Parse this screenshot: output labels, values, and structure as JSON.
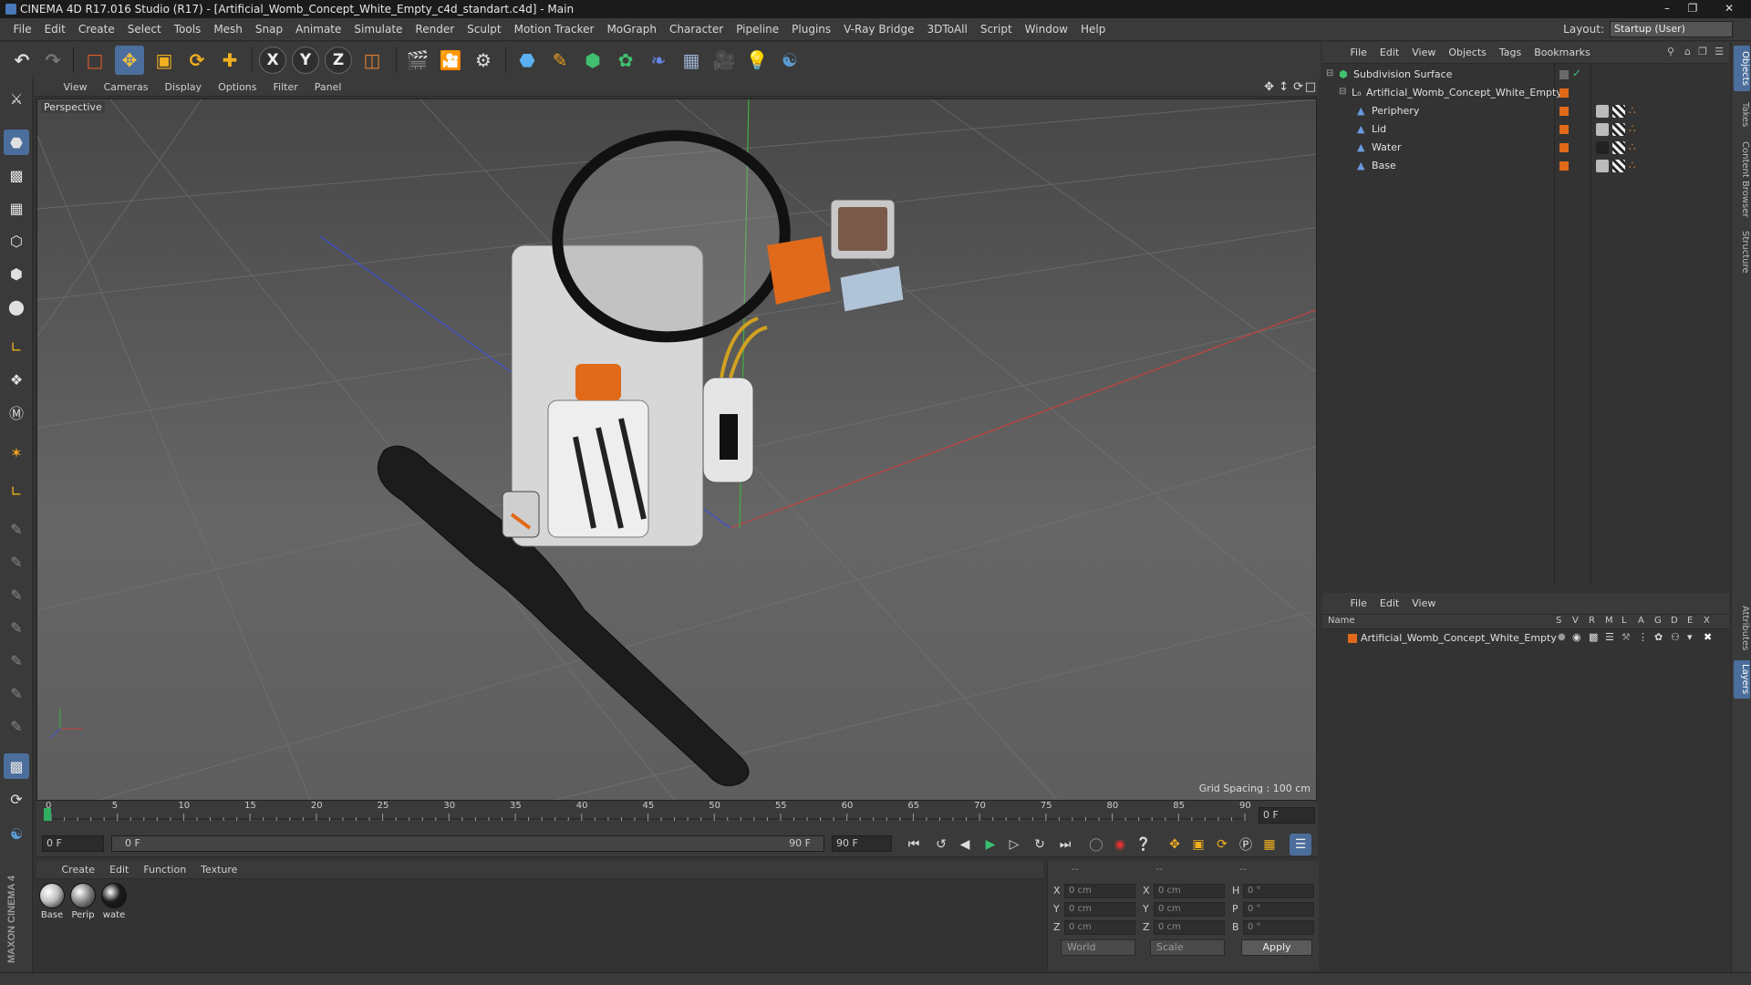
{
  "window": {
    "title": "CINEMA 4D R17.016 Studio (R17) - [Artificial_Womb_Concept_White_Empty_c4d_standart.c4d] - Main"
  },
  "menubar": {
    "items": [
      "File",
      "Edit",
      "Create",
      "Select",
      "Tools",
      "Mesh",
      "Snap",
      "Animate",
      "Simulate",
      "Render",
      "Sculpt",
      "Motion Tracker",
      "MoGraph",
      "Character",
      "Pipeline",
      "Plugins",
      "V-Ray Bridge",
      "3DToAll",
      "Script",
      "Window",
      "Help"
    ],
    "layout_label": "Layout:",
    "layout_value": "Startup (User)"
  },
  "toolbar": {
    "axis_x": "X",
    "axis_y": "Y",
    "axis_z": "Z"
  },
  "viewport": {
    "menu": [
      "View",
      "Cameras",
      "Display",
      "Options",
      "Filter",
      "Panel"
    ],
    "label": "Perspective",
    "grid_spacing": "Grid Spacing : 100 cm"
  },
  "timeline": {
    "ticks": [
      "0",
      "5",
      "10",
      "15",
      "20",
      "25",
      "30",
      "35",
      "40",
      "45",
      "50",
      "55",
      "60",
      "65",
      "70",
      "75",
      "80",
      "85",
      "90"
    ],
    "current_frame": "0 F",
    "start_field": "0 F",
    "range_start": "0 F",
    "range_end": "90 F",
    "end_field": "90 F"
  },
  "materials": {
    "menu": [
      "Create",
      "Edit",
      "Function",
      "Texture"
    ],
    "items": [
      {
        "name": "Base",
        "color": "#bdbdbd"
      },
      {
        "name": "Perip",
        "color": "#8a8a8a"
      },
      {
        "name": "wate",
        "color": "#1a1a1a"
      }
    ]
  },
  "coords": {
    "header_dashes": [
      "--",
      "--",
      "--"
    ],
    "rows": [
      {
        "l1": "X",
        "v1": "0 cm",
        "l2": "X",
        "v2": "0 cm",
        "l3": "H",
        "v3": "0 °"
      },
      {
        "l1": "Y",
        "v1": "0 cm",
        "l2": "Y",
        "v2": "0 cm",
        "l3": "P",
        "v3": "0 °"
      },
      {
        "l1": "Z",
        "v1": "0 cm",
        "l2": "Z",
        "v2": "0 cm",
        "l3": "B",
        "v3": "0 °"
      }
    ],
    "world": "World",
    "scale": "Scale",
    "apply": "Apply"
  },
  "objects": {
    "menu": [
      "File",
      "Edit",
      "View",
      "Objects",
      "Tags",
      "Bookmarks"
    ],
    "tree": [
      {
        "name": "Subdivision Surface",
        "indent": 0
      },
      {
        "name": "Artificial_Womb_Concept_White_Empty",
        "indent": 1
      },
      {
        "name": "Periphery",
        "indent": 2
      },
      {
        "name": "Lid",
        "indent": 2
      },
      {
        "name": "Water",
        "indent": 2
      },
      {
        "name": "Base",
        "indent": 2
      }
    ]
  },
  "layers": {
    "menu": [
      "File",
      "Edit",
      "View"
    ],
    "columns": [
      "Name",
      "S",
      "V",
      "R",
      "M",
      "L",
      "A",
      "G",
      "D",
      "E",
      "X"
    ],
    "rows": [
      "Artificial_Womb_Concept_White_Empty"
    ],
    "layer_color": "#e06a1a"
  },
  "side_tabs": [
    "Objects",
    "Takes",
    "Content Browser",
    "Structure",
    "Attributes",
    "Layers"
  ],
  "brand": "MAXON CINEMA 4D",
  "colors": {
    "accent": "#4b6e9c",
    "orange": "#e06a1a",
    "axis_x": "#c84040",
    "axis_y": "#40b040",
    "axis_z": "#4050d0"
  }
}
